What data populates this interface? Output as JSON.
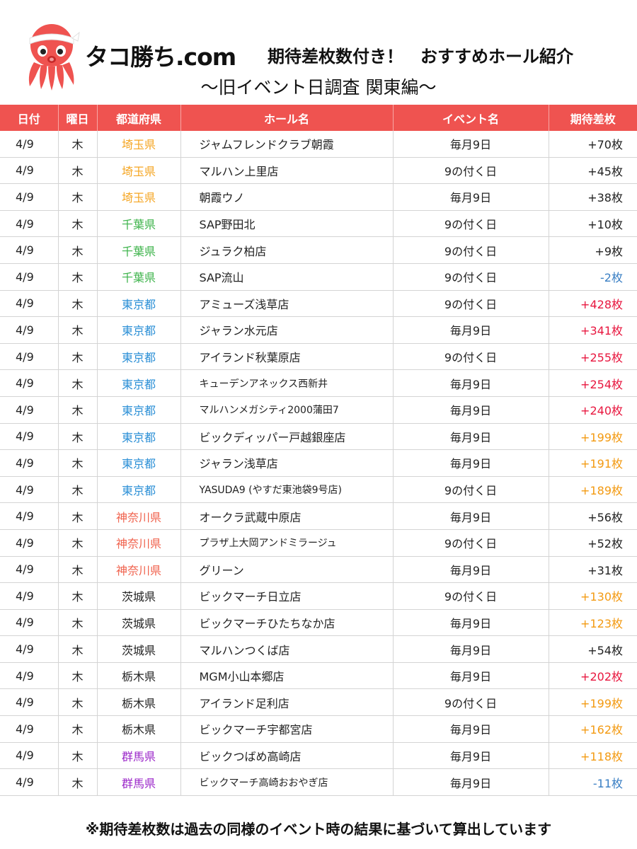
{
  "header": {
    "brand": "タコ勝ち.com",
    "subtitle": "期待差枚数付き！　おすすめホール紹介",
    "subtitle2": "〜旧イベント日調査 関東編〜"
  },
  "table": {
    "columns": [
      "日付",
      "曜日",
      "都道府県",
      "ホール名",
      "イベント名",
      "期待差枚"
    ],
    "rows": [
      {
        "date": "4/9",
        "day": "木",
        "pref": "埼玉県",
        "hall": "ジャムフレンドクラブ朝霞",
        "event": "毎月9日",
        "diff": "+70枚"
      },
      {
        "date": "4/9",
        "day": "木",
        "pref": "埼玉県",
        "hall": "マルハン上里店",
        "event": "9の付く日",
        "diff": "+45枚"
      },
      {
        "date": "4/9",
        "day": "木",
        "pref": "埼玉県",
        "hall": "朝霞ウノ",
        "event": "毎月9日",
        "diff": "+38枚"
      },
      {
        "date": "4/9",
        "day": "木",
        "pref": "千葉県",
        "hall": "SAP野田北",
        "event": "9の付く日",
        "diff": "+10枚"
      },
      {
        "date": "4/9",
        "day": "木",
        "pref": "千葉県",
        "hall": "ジュラク柏店",
        "event": "9の付く日",
        "diff": "+9枚"
      },
      {
        "date": "4/9",
        "day": "木",
        "pref": "千葉県",
        "hall": "SAP流山",
        "event": "9の付く日",
        "diff": "-2枚"
      },
      {
        "date": "4/9",
        "day": "木",
        "pref": "東京都",
        "hall": "アミューズ浅草店",
        "event": "9の付く日",
        "diff": "+428枚"
      },
      {
        "date": "4/9",
        "day": "木",
        "pref": "東京都",
        "hall": "ジャラン水元店",
        "event": "毎月9日",
        "diff": "+341枚"
      },
      {
        "date": "4/9",
        "day": "木",
        "pref": "東京都",
        "hall": "アイランド秋葉原店",
        "event": "9の付く日",
        "diff": "+255枚"
      },
      {
        "date": "4/9",
        "day": "木",
        "pref": "東京都",
        "hall": "キューデンアネックス西新井",
        "event": "毎月9日",
        "diff": "+254枚"
      },
      {
        "date": "4/9",
        "day": "木",
        "pref": "東京都",
        "hall": "マルハンメガシティ2000蒲田7",
        "event": "毎月9日",
        "diff": "+240枚"
      },
      {
        "date": "4/9",
        "day": "木",
        "pref": "東京都",
        "hall": "ビックディッパー戸越銀座店",
        "event": "毎月9日",
        "diff": "+199枚"
      },
      {
        "date": "4/9",
        "day": "木",
        "pref": "東京都",
        "hall": "ジャラン浅草店",
        "event": "毎月9日",
        "diff": "+191枚"
      },
      {
        "date": "4/9",
        "day": "木",
        "pref": "東京都",
        "hall": "YASUDA9 (やすだ東池袋9号店)",
        "event": "9の付く日",
        "diff": "+189枚"
      },
      {
        "date": "4/9",
        "day": "木",
        "pref": "神奈川県",
        "hall": "オークラ武蔵中原店",
        "event": "毎月9日",
        "diff": "+56枚"
      },
      {
        "date": "4/9",
        "day": "木",
        "pref": "神奈川県",
        "hall": "プラザ上大岡アンドミラージュ",
        "event": "9の付く日",
        "diff": "+52枚"
      },
      {
        "date": "4/9",
        "day": "木",
        "pref": "神奈川県",
        "hall": "グリーン",
        "event": "毎月9日",
        "diff": "+31枚"
      },
      {
        "date": "4/9",
        "day": "木",
        "pref": "茨城県",
        "hall": "ビックマーチ日立店",
        "event": "9の付く日",
        "diff": "+130枚"
      },
      {
        "date": "4/9",
        "day": "木",
        "pref": "茨城県",
        "hall": "ビックマーチひたちなか店",
        "event": "毎月9日",
        "diff": "+123枚"
      },
      {
        "date": "4/9",
        "day": "木",
        "pref": "茨城県",
        "hall": "マルハンつくば店",
        "event": "毎月9日",
        "diff": "+54枚"
      },
      {
        "date": "4/9",
        "day": "木",
        "pref": "栃木県",
        "hall": "MGM小山本郷店",
        "event": "毎月9日",
        "diff": "+202枚"
      },
      {
        "date": "4/9",
        "day": "木",
        "pref": "栃木県",
        "hall": "アイランド足利店",
        "event": "9の付く日",
        "diff": "+199枚"
      },
      {
        "date": "4/9",
        "day": "木",
        "pref": "栃木県",
        "hall": "ビックマーチ宇都宮店",
        "event": "毎月9日",
        "diff": "+162枚"
      },
      {
        "date": "4/9",
        "day": "木",
        "pref": "群馬県",
        "hall": "ビックつばめ高崎店",
        "event": "毎月9日",
        "diff": "+118枚"
      },
      {
        "date": "4/9",
        "day": "木",
        "pref": "群馬県",
        "hall": "ビックマーチ高崎おおやぎ店",
        "event": "毎月9日",
        "diff": "-11枚"
      }
    ]
  },
  "footer": {
    "note": "※期待差枚数は過去の同様のイベント時の結果に基づいて算出しています"
  },
  "colors": {
    "header_bg": "#ef5350",
    "pref": {
      "埼玉県": "#f5a623",
      "千葉県": "#3cb34a",
      "東京都": "#2b8fd6",
      "神奈川県": "#f0624d",
      "茨城県": "#222222",
      "栃木県": "#222222",
      "群馬県": "#9b27c9"
    },
    "diff_high": "#e8173f",
    "diff_mid": "#f39a12",
    "diff_normal": "#222222",
    "diff_negative": "#3a7fc4"
  }
}
